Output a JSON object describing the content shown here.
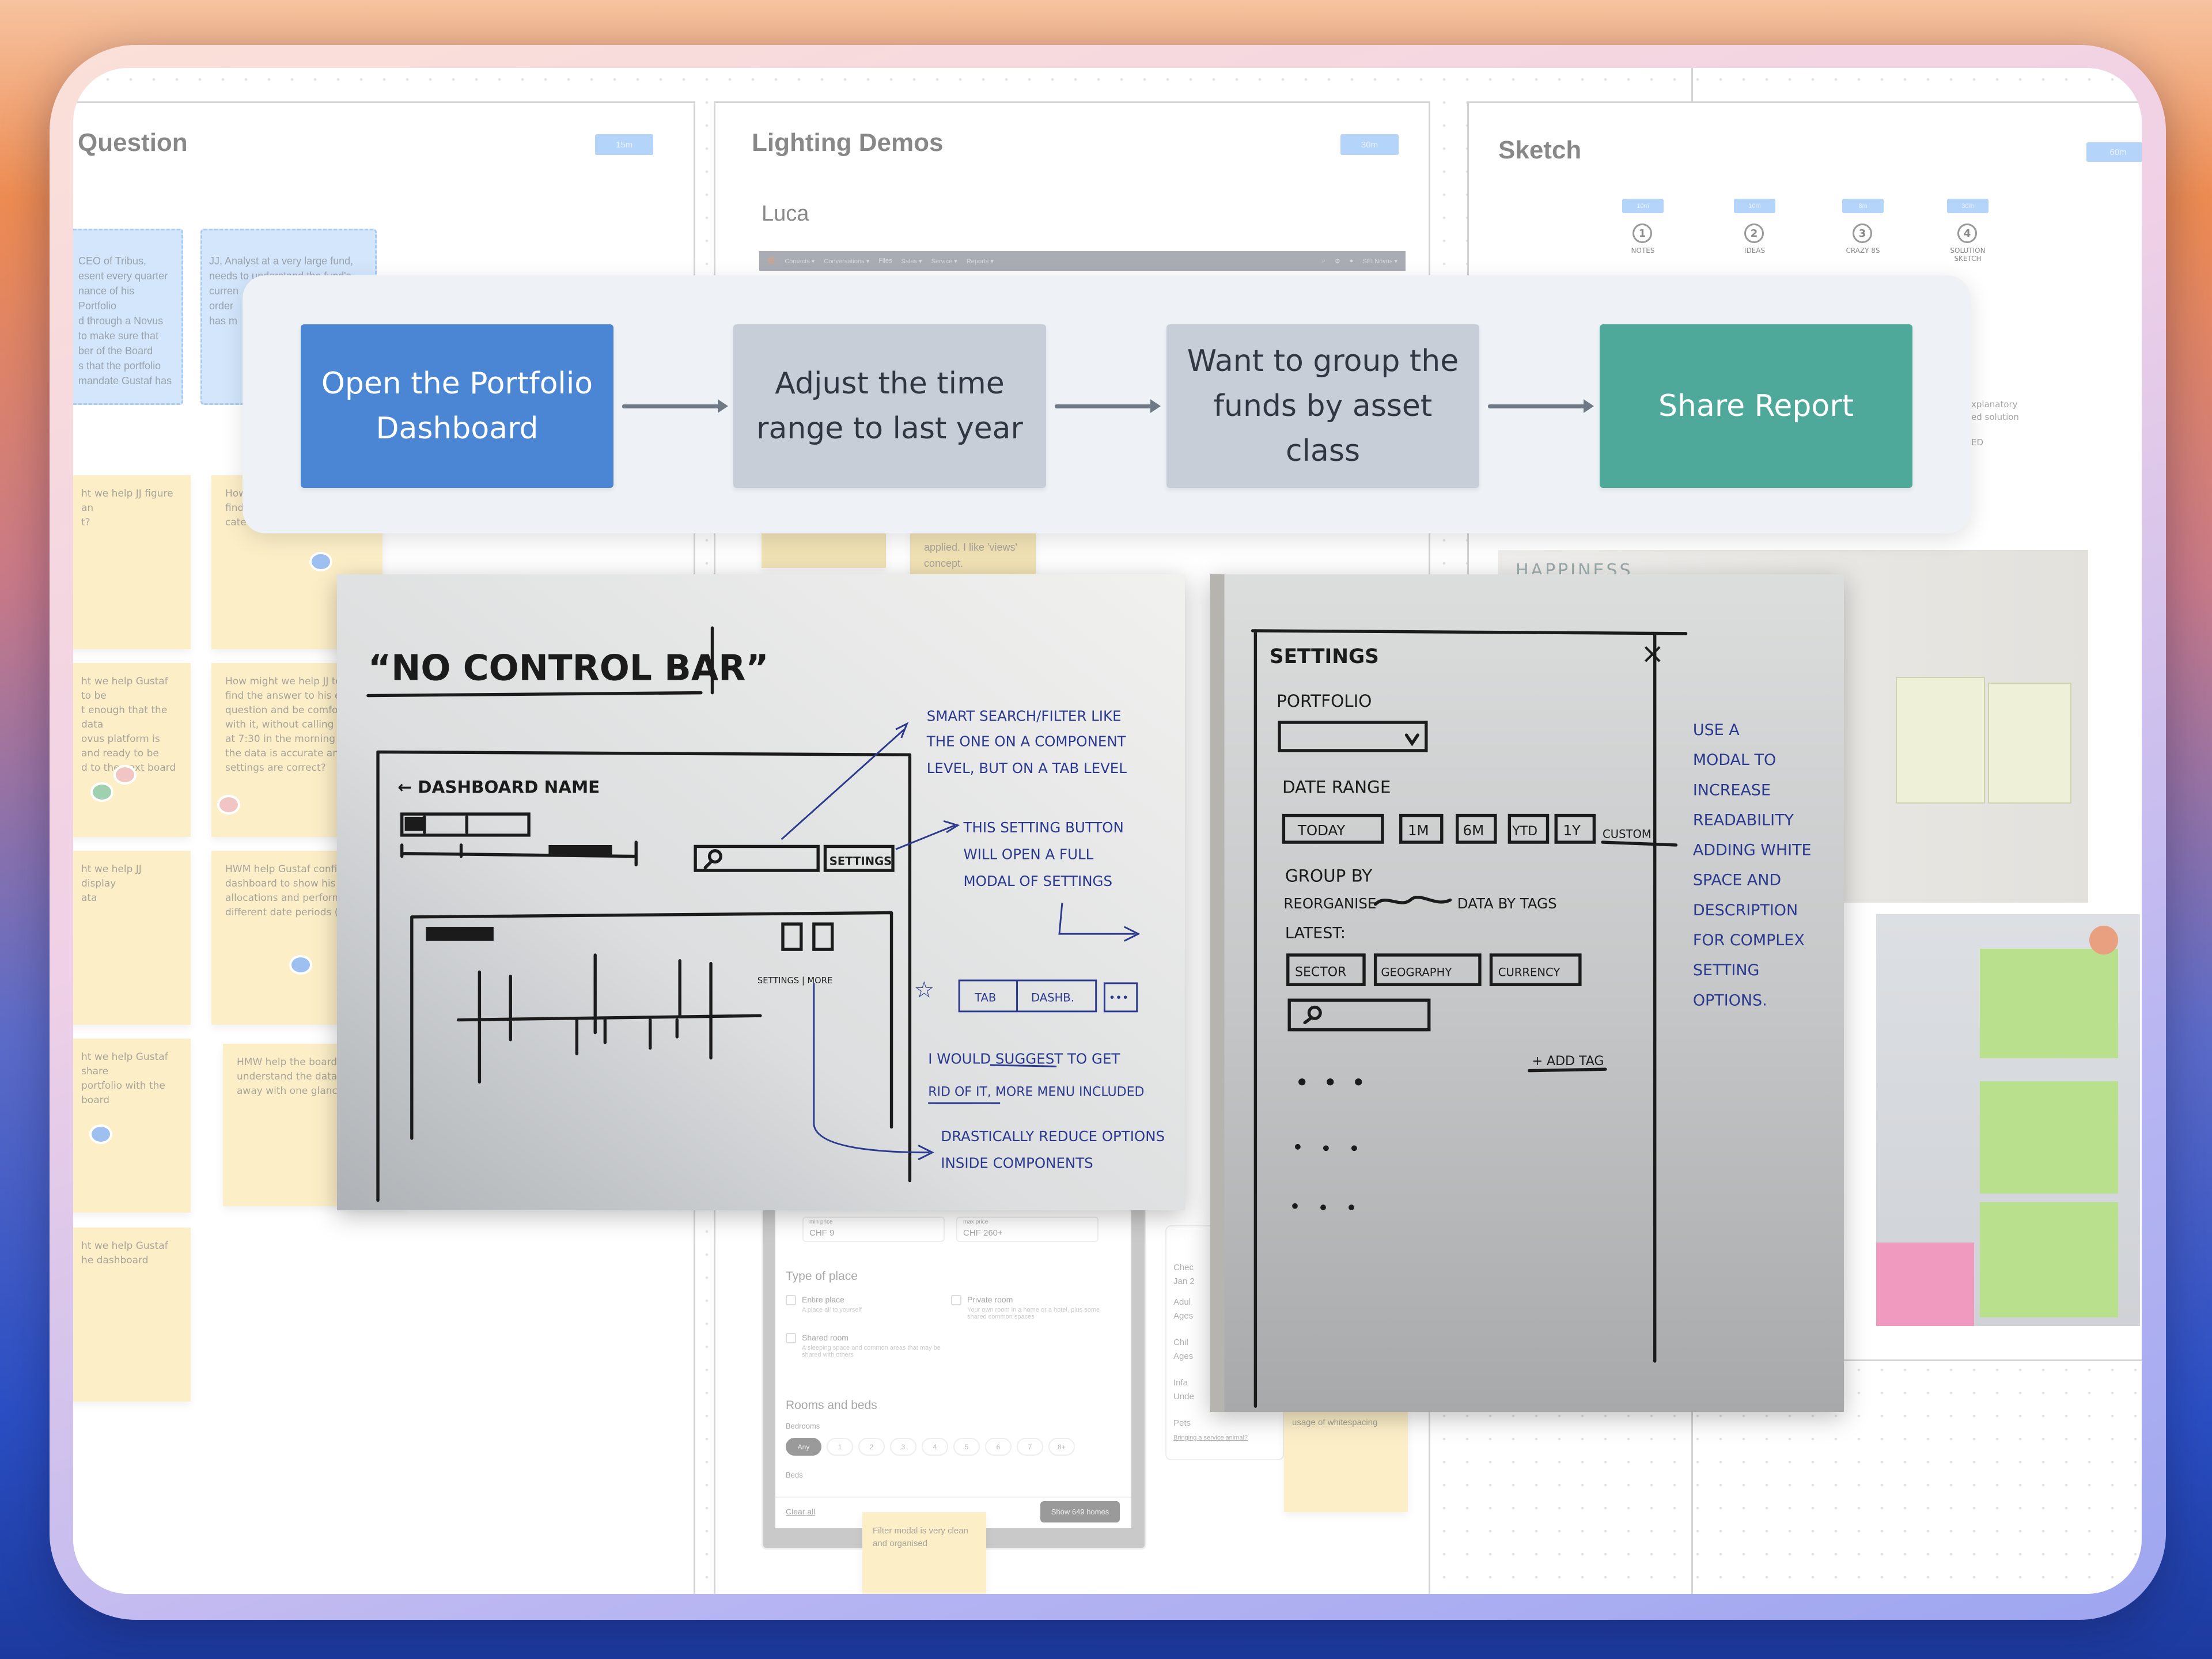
{
  "colors": {
    "flow_blue": "#4a86d4",
    "flow_grey": "#c8ced8",
    "flow_teal": "#4fa99a",
    "badge": "#b4d4fa",
    "sticky_yellow": "#fcefc8",
    "sticky_blue": "#d3e6fb",
    "ink_blue": "#2b3a8f",
    "ink_black": "#1b1b1b"
  },
  "sections": {
    "question": {
      "title": "Question",
      "timer": "15m",
      "persona_notes": [
        {
          "text": "CEO of Tribus,\nesent every quarter\nnance of his Portfolio\nd through a Novus\nto make sure that\nber of the Board\ns that the portfolio\nmandate Gustaf has"
        },
        {
          "text": "JJ, Analyst at a very large fund,\nneeds to understand the fund's\ncurren\norder\nhas m"
        }
      ],
      "hmw_notes": [
        {
          "text": "ht we help JJ figure an\nt?"
        },
        {
          "text": "How\nfind\ncate"
        },
        {
          "text": "ht we help Gustaf to be\nt enough that the data\novus platform is\nand ready to be\nd to the next board"
        },
        {
          "text": "How might we help JJ to\nfind the answer to his exp\nquestion and be comforta\nwith it, without calling Mi\nat 7:30 in the morning to\nthe data is accurate and i\nsettings are correct?"
        },
        {
          "text": "ht we help JJ display\nata"
        },
        {
          "text": "HWM help Gustaf config\ndashboard to show his\nallocations and performa\ndifferent date periods (M"
        },
        {
          "text": "ht we help Gustaf share\nportfolio with the board"
        },
        {
          "text": "HMW help the board\nunderstand the data\naway with one glanc"
        },
        {
          "text": "ht we help Gustaf\nhe dashboard"
        }
      ]
    },
    "lighting": {
      "title": "Lighting Demos",
      "timer": "30m",
      "presenter": "Luca",
      "nav": {
        "items": [
          "Contacts ▾",
          "Conversations ▾",
          "Files",
          "Sales ▾",
          "Service ▾",
          "Reports ▾"
        ],
        "user": "SEI Novus ▾"
      },
      "notes": [
        {
          "text": ""
        },
        {
          "text": "applied. I like 'views'\nconcept."
        },
        {
          "text": "usage of whitespacing"
        },
        {
          "text": "Filter modal is very clean\nand organised"
        }
      ],
      "filter_modal": {
        "min_label": "min price",
        "min_value": "CHF 9",
        "max_label": "max price",
        "max_value": "CHF 260+",
        "type_heading": "Type of place",
        "options": [
          {
            "label": "Entire place",
            "desc": "A place all to yourself"
          },
          {
            "label": "Private room",
            "desc": "Your own room in a home or a hotel, plus some shared common spaces"
          },
          {
            "label": "Shared room",
            "desc": "A sleeping space and common areas that may be shared with others"
          }
        ],
        "rooms_heading": "Rooms and beds",
        "bedrooms_label": "Bedrooms",
        "beds_label": "Beds",
        "counts": [
          "Any",
          "1",
          "2",
          "3",
          "4",
          "5",
          "6",
          "7",
          "8+"
        ],
        "clear_label": "Clear all",
        "show_label": "Show 649 homes"
      },
      "booking_card": {
        "rows": [
          "Chec",
          "Jan 2",
          "Adul",
          "Ages",
          "Chil",
          "Ages",
          "Infa",
          "Unde",
          "Pets"
        ],
        "link": "Bringing a service animal?"
      }
    },
    "sketch": {
      "title": "Sketch",
      "timer": "60m",
      "steps": [
        {
          "number": "1",
          "label": "NOTES",
          "timer": "10m"
        },
        {
          "number": "2",
          "label": "IDEAS",
          "timer": "10m"
        },
        {
          "number": "3",
          "label": "CRAZY 8s",
          "timer": "8m"
        },
        {
          "number": "4",
          "label": "SOLUTION SKETCH",
          "timer": "30m"
        }
      ],
      "note_fragment": "xplanatory\ned solution\n\nED",
      "photo_heading": "HAPPINESS"
    }
  },
  "flow": {
    "steps": [
      {
        "label": "Open the Portfolio Dashboard"
      },
      {
        "label": "Adjust the time range to last year"
      },
      {
        "label": "Want to group the funds by asset class"
      },
      {
        "label": "Share Report"
      }
    ]
  },
  "photos": {
    "no_control_bar": {
      "title": "“NO CONTROL BAR”",
      "dashboard_name": "← DASHBOARD NAME",
      "settings_button": "SETTINGS",
      "icon_labels": "SETTINGS | MORE",
      "note_search": [
        "SMART SEARCH/FILTER LIKE",
        "THE ONE ON A COMPONENT",
        "LEVEL, BUT ON A TAB LEVEL"
      ],
      "note_settings": [
        "THIS SETTING BUTTON",
        "WILL OPEN A FULL",
        "MODAL OF SETTINGS"
      ],
      "tab_labels": [
        "TAB",
        "DASHB.",
        "•••"
      ],
      "note_suggest": [
        "I WOULD SUGGEST TO GET",
        "RID OF IT, MORE MENU INCLUDED"
      ],
      "note_reduce": [
        "DRASTICALLY REDUCE OPTIONS",
        "INSIDE COMPONENTS"
      ]
    },
    "settings_modal": {
      "title": "SETTINGS",
      "close": "×",
      "portfolio_label": "PORTFOLIO",
      "date_range_label": "DATE RANGE",
      "date_chips": [
        "TODAY",
        "1M",
        "6M",
        "YTD",
        "1Y"
      ],
      "custom": "CUSTOM",
      "group_by": "GROUP BY",
      "reorganise": "REORGANISE",
      "reorganise_tail": "DATA BY TAGS",
      "latest": "LATEST:",
      "tag_chips": [
        "SECTOR",
        "GEOGRAPHY",
        "CURRENCY"
      ],
      "add_tag": "+ ADD TAG",
      "note": [
        "USE A",
        "MODAL TO",
        "INCREASE",
        "READABILITY",
        "ADDING WHITE",
        "SPACE AND",
        "DESCRIPTION",
        "FOR COMPLEX",
        "SETTING",
        "OPTIONS."
      ]
    }
  }
}
